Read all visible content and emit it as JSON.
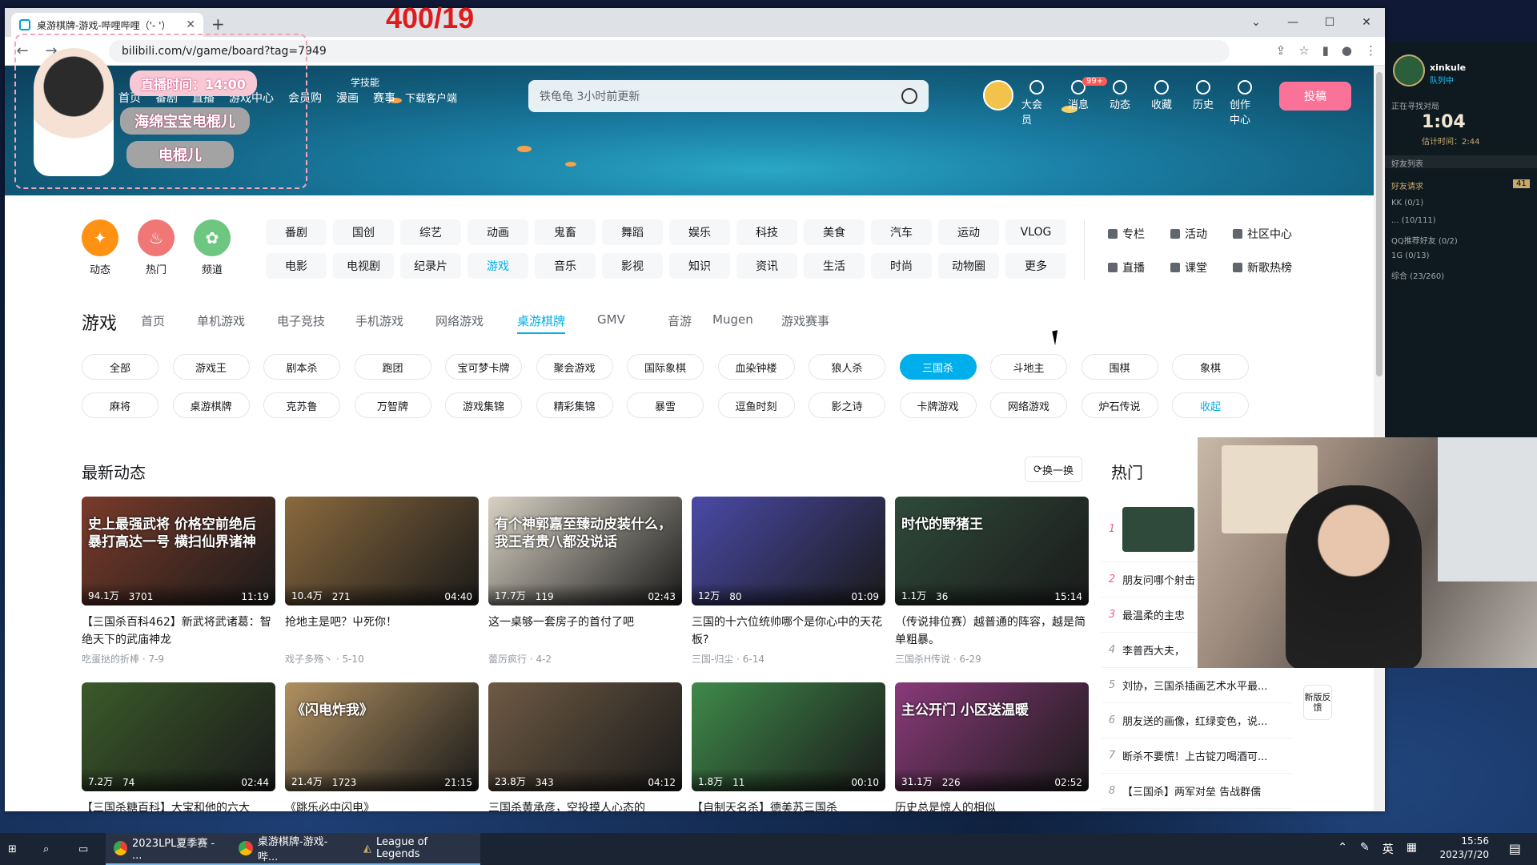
{
  "overlay": {
    "score": "400/19",
    "live_time": "直播时间：14:00",
    "name_1": "海绵宝宝电棍儿",
    "name_2": "电棍儿"
  },
  "browser": {
    "tab_title": "桌游棋牌-游戏-哔哩哔哩（'- '）",
    "url": "bilibili.com/v/game/board?tag=7949"
  },
  "header": {
    "nav": [
      "首页",
      "番剧",
      "直播",
      "游戏中心",
      "会员购",
      "漫画",
      "赛事"
    ],
    "extra_nav": "学技能",
    "download": "下载客户端",
    "search_placeholder": "铁龟龟 3小时前更新",
    "icons": [
      {
        "label": "大会员",
        "icon": "vip-icon"
      },
      {
        "label": "消息",
        "icon": "message-icon"
      },
      {
        "label": "动态",
        "icon": "dynamic-icon"
      },
      {
        "label": "收藏",
        "icon": "star-icon"
      },
      {
        "label": "历史",
        "icon": "history-icon"
      },
      {
        "label": "创作中心",
        "icon": "bulb-icon"
      }
    ],
    "message_badge": "99+",
    "upload": "投稿"
  },
  "quick": [
    {
      "label": "动态",
      "color": "#ff9212"
    },
    {
      "label": "热门",
      "color": "#f07775"
    },
    {
      "label": "频道",
      "color": "#6dc781"
    }
  ],
  "channels": [
    [
      "番剧",
      "国创",
      "综艺",
      "动画",
      "鬼畜",
      "舞蹈",
      "娱乐",
      "科技",
      "美食",
      "汽车",
      "运动",
      "VLOG"
    ],
    [
      "电影",
      "电视剧",
      "纪录片",
      "游戏",
      "音乐",
      "影视",
      "知识",
      "资讯",
      "生活",
      "时尚",
      "动物圈",
      "更多"
    ]
  ],
  "side_links": [
    [
      "专栏",
      "活动",
      "社区中心"
    ],
    [
      "直播",
      "课堂",
      "新歌热榜"
    ]
  ],
  "category": {
    "title": "游戏",
    "subnav": [
      "首页",
      "单机游戏",
      "电子竞技",
      "手机游戏",
      "网络游戏",
      "桌游棋牌",
      "GMV",
      "音游",
      "Mugen",
      "游戏赛事"
    ],
    "active_subnav": 5
  },
  "tags": [
    [
      "全部",
      "游戏王",
      "剧本杀",
      "跑团",
      "宝可梦卡牌",
      "聚会游戏",
      "国际象棋",
      "血染钟楼",
      "狼人杀",
      "三国杀",
      "斗地主",
      "围棋",
      "象棋"
    ],
    [
      "麻将",
      "桌游棋牌",
      "克苏鲁",
      "万智牌",
      "游戏集锦",
      "精彩集锦",
      "暴雪",
      "逗鱼时刻",
      "影之诗",
      "卡牌游戏",
      "网络游戏",
      "炉石传说",
      "收起"
    ]
  ],
  "active_tag": "三国杀",
  "latest": {
    "title": "最新动态",
    "refresh": "换一换",
    "videos": [
      {
        "cap": "史上最强武将 价格空前绝后 暴打高达一号 横扫仙界诸神",
        "views": "94.1万",
        "danmaku": "3701",
        "dur": "11:19",
        "title": "【三国杀百科462】新武将武诸葛：智绝天下的武庙神龙",
        "up": "吃蛋挞的折棒",
        "date": "7-9",
        "bg": "#7a3b2a"
      },
      {
        "cap": "",
        "views": "10.4万",
        "danmaku": "271",
        "dur": "04:40",
        "title": "抢地主是吧？屮死你！",
        "up": "戏子多殇丶",
        "date": "5-10",
        "bg": "#8b6a3e"
      },
      {
        "cap": "有个神郭嘉至臻动皮装什么，我王者贵八都没说话",
        "views": "17.7万",
        "danmaku": "119",
        "dur": "02:43",
        "title": "这一桌够一套房子的首付了吧",
        "up": "蕾厉疯行",
        "date": "4-2",
        "bg": "#d8d2c4"
      },
      {
        "cap": "",
        "views": "12万",
        "danmaku": "80",
        "dur": "01:09",
        "title": "三国的十六位统帅哪个是你心中的天花板?",
        "up": "三国-归尘",
        "date": "6-14",
        "bg": "#4a4aa8"
      },
      {
        "cap": "时代的野猪王",
        "views": "1.1万",
        "danmaku": "36",
        "dur": "15:14",
        "title": "（传说排位赛）越普通的阵容，越是简单粗暴。",
        "up": "三国杀H传说",
        "date": "6-29",
        "bg": "#2f4a3a"
      },
      {
        "cap": "",
        "views": "7.2万",
        "danmaku": "74",
        "dur": "02:44",
        "title": "【三国杀糖百科】大宝和他的六大",
        "up": "",
        "date": "",
        "bg": "#3b5a2a"
      },
      {
        "cap": "《闪电炸我》",
        "views": "21.4万",
        "danmaku": "1723",
        "dur": "21:15",
        "title": "《跳乐必中闪电》",
        "up": "",
        "date": "",
        "bg": "#b09060"
      },
      {
        "cap": "",
        "views": "23.8万",
        "danmaku": "343",
        "dur": "04:12",
        "title": "三国杀黄承彦，空投摸人心态的",
        "up": "",
        "date": "",
        "bg": "#6e5a44"
      },
      {
        "cap": "",
        "views": "1.8万",
        "danmaku": "11",
        "dur": "00:10",
        "title": "【自制天名杀】德美苏三国杀",
        "up": "",
        "date": "",
        "bg": "#3f8a4a"
      },
      {
        "cap": "主公开门 小区送温暖",
        "views": "31.1万",
        "danmaku": "226",
        "dur": "02:52",
        "title": "历史总是惊人的相似",
        "up": "",
        "date": "",
        "bg": "#8a3a7a"
      }
    ]
  },
  "hot": {
    "title": "热门",
    "items": [
      {
        "n": "1",
        "t": ""
      },
      {
        "n": "2",
        "t": "朋友问哪个射击"
      },
      {
        "n": "3",
        "t": "最温柔的主忠"
      },
      {
        "n": "4",
        "t": "李普西大夫，"
      },
      {
        "n": "5",
        "t": "刘协，三国杀插画艺术水平最..."
      },
      {
        "n": "6",
        "t": "朋友送的画像，红绿变色，说..."
      },
      {
        "n": "7",
        "t": "断杀不要慌！上古锭刀喝酒可..."
      },
      {
        "n": "8",
        "t": "【三国杀】两军对垒 告战群儒"
      }
    ],
    "feedback": "新版反馈"
  },
  "client": {
    "name": "xinkule",
    "status": "队列中",
    "queue_label": "正在寻找对局",
    "timer": "1:04",
    "estimate": "估计时间：2:44",
    "friends_bar": "好友列表",
    "friend_requests": "好友请求",
    "friend_requests_count": "41",
    "groups": [
      "KK (0/1)",
      "... (10/111)",
      "QQ推荐好友 (0/2)",
      "1G (0/13)",
      "综合 (23/260)"
    ]
  },
  "taskbar": {
    "apps": [
      "2023LPL夏季赛 - ...",
      "桌游棋牌-游戏-哔...",
      "League of Legends"
    ],
    "ime": "英",
    "time": "15:56",
    "date": "2023/7/20"
  }
}
